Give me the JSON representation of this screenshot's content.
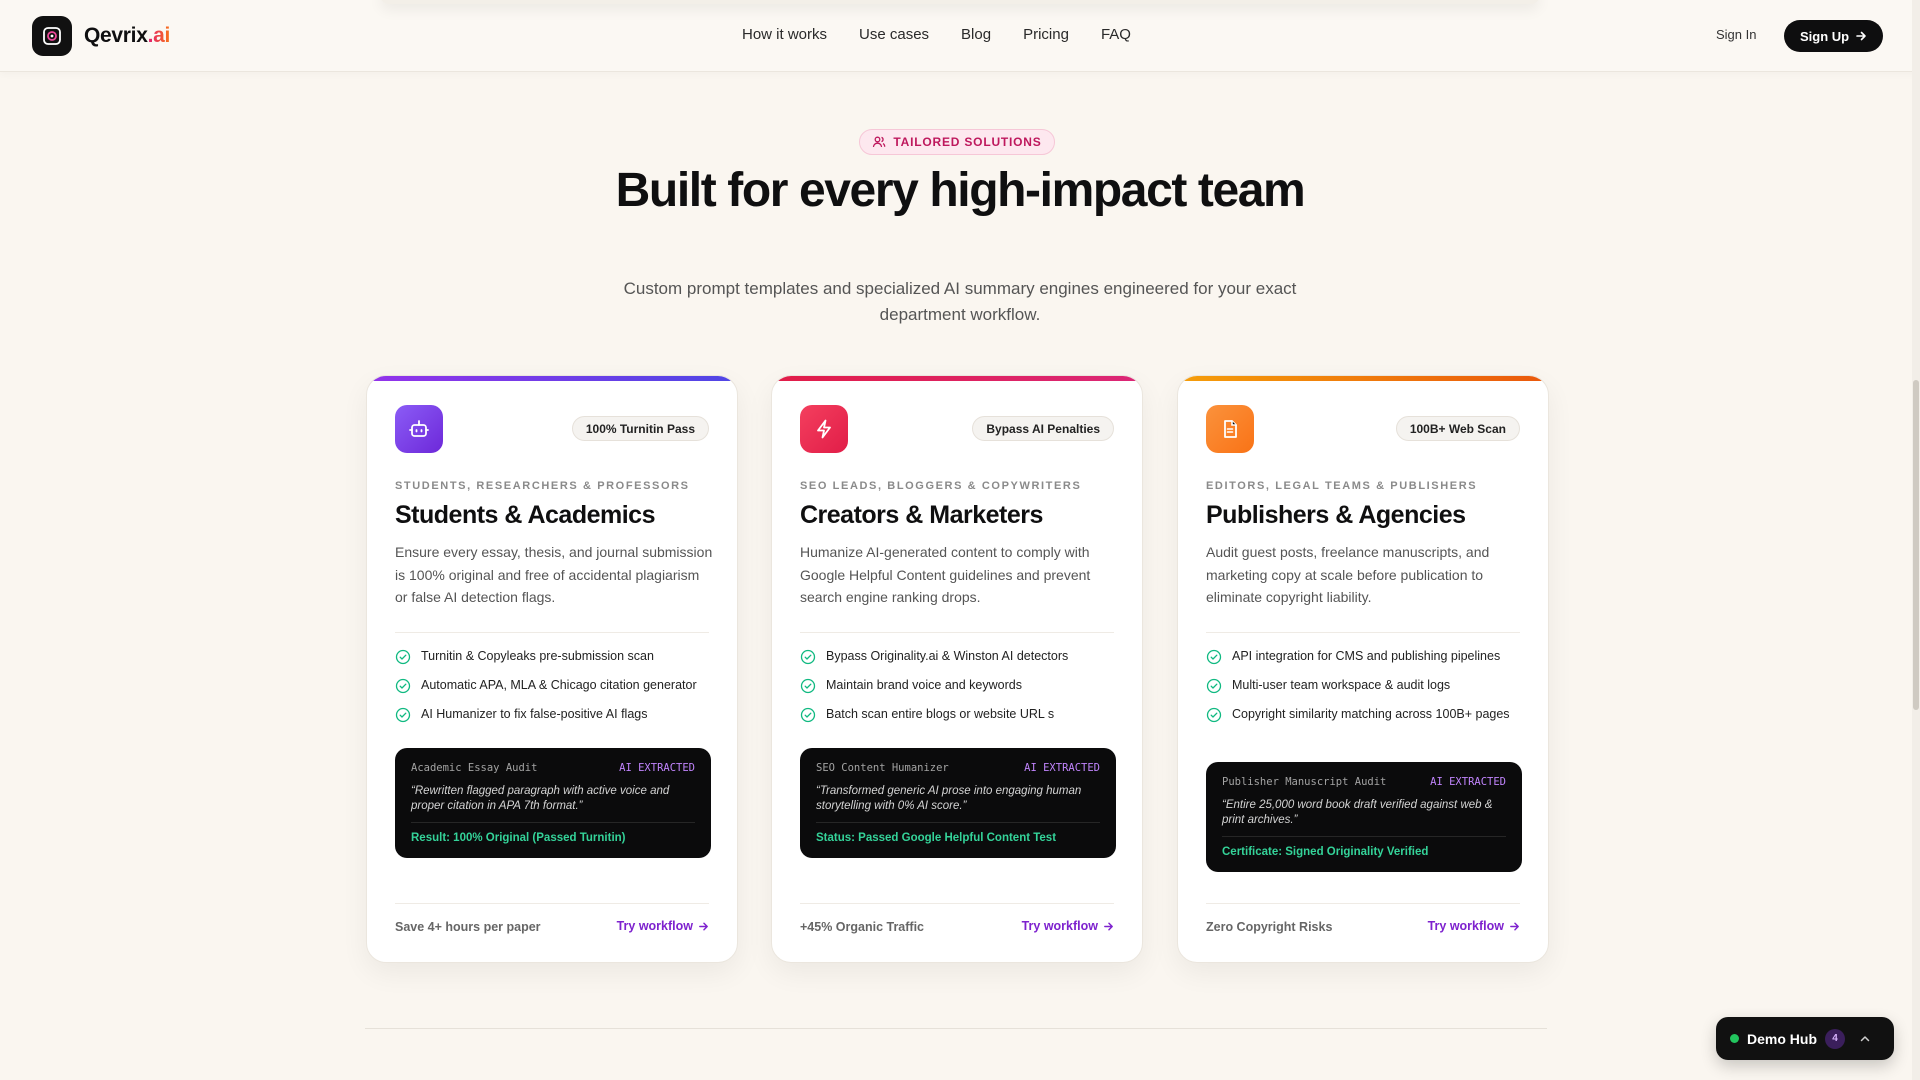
{
  "nav": {
    "brand_name": "Qevrix",
    "brand_suffix": ".ai",
    "links": [
      "How it works",
      "Use cases",
      "Blog",
      "Pricing",
      "FAQ"
    ],
    "sign_in": "Sign In",
    "sign_up": "Sign Up"
  },
  "hero": {
    "pill": "TAILORED SOLUTIONS",
    "title": "Built for every high-impact team",
    "subtitle": "Custom prompt templates and specialized AI summary engines engineered for your exact department workflow."
  },
  "cards": [
    {
      "badge": "100% Turnitin Pass",
      "kicker": "STUDENTS, RESEARCHERS & PROFESSORS",
      "title": "Students & Academics",
      "desc": "Ensure every essay, thesis, and journal submission is 100% original and free of accidental plagiarism or false AI detection flags.",
      "features": [
        "Turnitin & Copyleaks pre-submission scan",
        "Automatic APA, MLA & Chicago citation generator",
        "AI Humanizer to fix false-positive AI flags"
      ],
      "code_name": "Academic Essay Audit",
      "code_tag": "AI EXTRACTED",
      "code_quote": "“Rewritten flagged paragraph with active voice and proper citation in APA 7th format.”",
      "code_result": "Result: 100% Original (Passed Turnitin)",
      "metric": "Save 4+ hours per paper",
      "cta": "Try workflow",
      "color": "#7c3aed"
    },
    {
      "badge": "Bypass AI Penalties",
      "kicker": "SEO LEADS, BLOGGERS & COPYWRITERS",
      "title": "Creators & Marketers",
      "desc": "Humanize AI-generated content to comply with Google Helpful Content guidelines and prevent search engine ranking drops.",
      "features": [
        "Bypass Originality.ai & Winston AI detectors",
        "Maintain brand voice and keywords",
        "Batch scan entire blogs or website URL s"
      ],
      "code_name": "SEO Content Humanizer",
      "code_tag": "AI EXTRACTED",
      "code_quote": "“Transformed generic AI prose into engaging human storytelling with 0% AI score.”",
      "code_result": "Status: Passed Google Helpful Content Test",
      "metric": "+45% Organic Traffic",
      "cta": "Try workflow",
      "color": "#e11d48"
    },
    {
      "badge": "100B+ Web Scan",
      "kicker": "EDITORS, LEGAL TEAMS & PUBLISHERS",
      "title": "Publishers & Agencies",
      "desc": "Audit guest posts, freelance manuscripts, and marketing copy at scale before publication to eliminate copyright liability.",
      "features": [
        "API integration for CMS and publishing pipelines",
        "Multi-user team workspace & audit logs",
        "Copyright similarity matching across 100B+ pages"
      ],
      "code_name": "Publisher Manuscript Audit",
      "code_tag": "AI EXTRACTED",
      "code_quote": "“Entire 25,000 word book draft verified against web & print archives.”",
      "code_result": "Certificate: Signed Originality Verified",
      "metric": "Zero Copyright Risks",
      "cta": "Try workflow",
      "color": "#f97316"
    }
  ],
  "demo_hub": {
    "label": "Demo Hub",
    "count": "4"
  }
}
